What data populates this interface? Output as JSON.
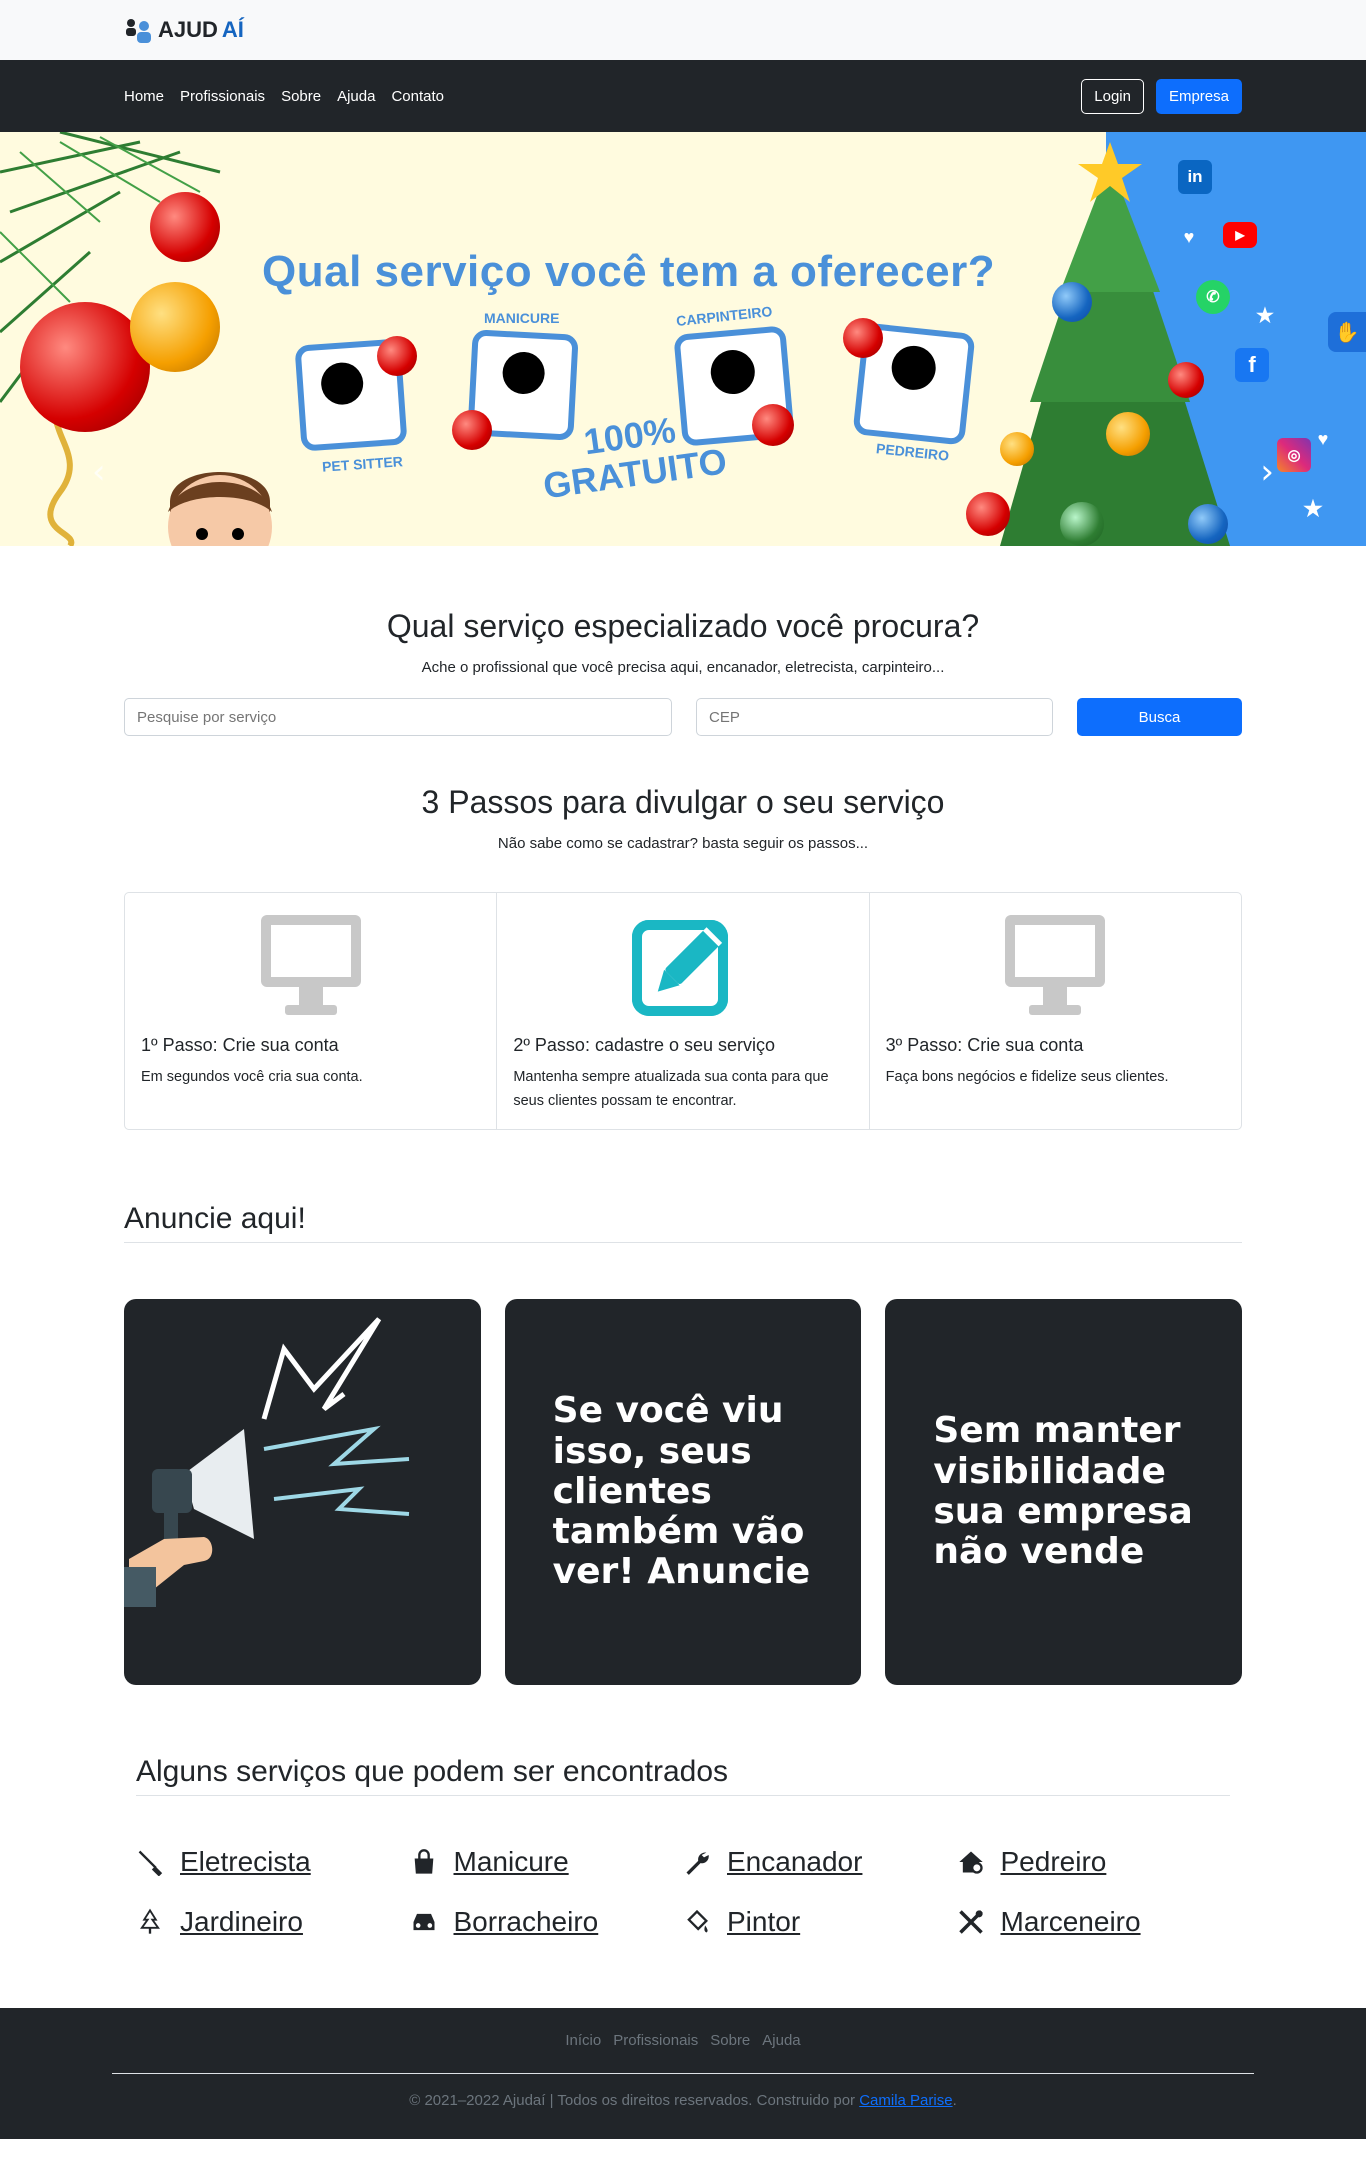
{
  "logo": {
    "text_a": "AJUD",
    "text_b": "AÍ"
  },
  "nav": {
    "links": [
      "Home",
      "Profissionais",
      "Sobre",
      "Ajuda",
      "Contato"
    ],
    "login_label": "Login",
    "empresa_label": "Empresa"
  },
  "hero": {
    "title": "Qual serviço você tem a oferecer?",
    "free_line1": "100%",
    "free_line2": "GRATUITO",
    "services": [
      "PET SITTER",
      "MANICURE",
      "CARPINTEIRO",
      "PEDREIRO"
    ]
  },
  "search": {
    "title": "Qual serviço especializado você procura?",
    "subtitle": "Ache o profissional que você precisa aqui, encanador, eletrecista, carpinteiro...",
    "service_placeholder": "Pesquise por serviço",
    "cep_placeholder": "CEP",
    "button_label": "Busca"
  },
  "steps": {
    "title": "3 Passos para divulgar o seu serviço",
    "subtitle": "Não sabe como se cadastrar? basta seguir os passos...",
    "items": [
      {
        "title": "1º Passo: Crie sua conta",
        "text": "Em segundos você cria sua conta.",
        "icon": "monitor-icon"
      },
      {
        "title": "2º Passo: cadastre o seu serviço",
        "text": "Mantenha sempre atualizada sua conta para que seus clientes possam te encontrar.",
        "icon": "edit-icon"
      },
      {
        "title": "3º Passo: Crie sua conta",
        "text": "Faça bons negócios e fidelize seus clientes.",
        "icon": "monitor-icon"
      }
    ]
  },
  "anuncie": {
    "title": "Anuncie aqui!",
    "card2": "Se você viu isso, seus clientes também vão ver! Anuncie",
    "card3": "Sem manter visibilidade sua empresa não vende"
  },
  "services": {
    "title": "Alguns serviços que podem ser encontrados",
    "items": [
      {
        "label": "Eletrecista",
        "icon": "screwdriver-icon"
      },
      {
        "label": "Manicure",
        "icon": "bag-icon"
      },
      {
        "label": "Encanador",
        "icon": "wrench-icon"
      },
      {
        "label": "Pedreiro",
        "icon": "house-gear-icon"
      },
      {
        "label": "Jardineiro",
        "icon": "tree-icon"
      },
      {
        "label": "Borracheiro",
        "icon": "car-icon"
      },
      {
        "label": "Pintor",
        "icon": "paint-bucket-icon"
      },
      {
        "label": "Marceneiro",
        "icon": "tools-icon"
      }
    ]
  },
  "footer": {
    "links": [
      "Início",
      "Profissionais",
      "Sobre",
      "Ajuda"
    ],
    "copyright": "© 2021–2022 Ajudaí | Todos os direitos reservados. Construido por ",
    "author": "Camila Parise",
    "end": "."
  },
  "colors": {
    "primary": "#0d6efd",
    "dark": "#212529",
    "banner_blue": "#4a90d9"
  }
}
